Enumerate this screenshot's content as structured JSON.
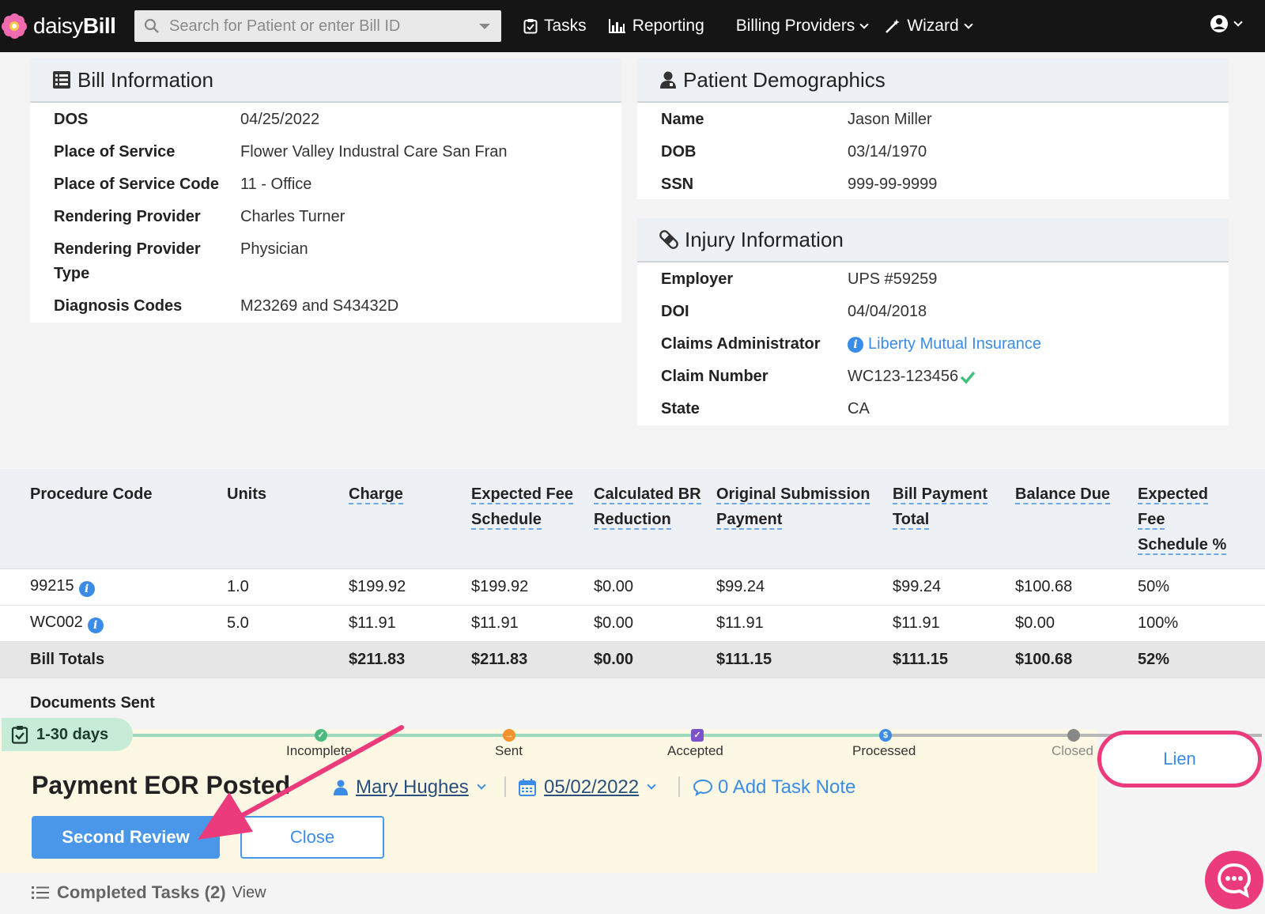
{
  "app": {
    "logo_regular": "daisy",
    "logo_bold": "Bill"
  },
  "nav": {
    "search_placeholder": "Search for Patient or enter Bill ID",
    "tasks": "Tasks",
    "reporting": "Reporting",
    "billing_providers": "Billing Providers",
    "wizard": "Wizard"
  },
  "bill_info": {
    "title": "Bill Information",
    "rows": [
      {
        "label": "DOS",
        "value": "04/25/2022"
      },
      {
        "label": "Place of Service",
        "value": "Flower Valley Industral Care San Fran"
      },
      {
        "label": "Place of Service Code",
        "value": "11 - Office"
      },
      {
        "label": "Rendering Provider",
        "value": "Charles Turner"
      },
      {
        "label_1": "Rendering Provider",
        "label_2": "Type",
        "value": "Physician"
      },
      {
        "label": "Diagnosis Codes",
        "value": "M23269 and S43432D"
      }
    ]
  },
  "demographics": {
    "title": "Patient Demographics",
    "rows": [
      {
        "label": "Name",
        "value": "Jason Miller"
      },
      {
        "label": "DOB",
        "value": "03/14/1970"
      },
      {
        "label": "SSN",
        "value": "999-99-9999"
      }
    ]
  },
  "injury": {
    "title": "Injury Information",
    "rows": [
      {
        "label": "Employer",
        "value": "UPS #59259"
      },
      {
        "label": "DOI",
        "value": "04/04/2018"
      },
      {
        "label": "Claims Administrator",
        "value": "Liberty Mutual Insurance"
      },
      {
        "label": "Claim Number",
        "value": "WC123-123456"
      },
      {
        "label": "State",
        "value": "CA"
      }
    ]
  },
  "procedures": {
    "headers": [
      {
        "l1": "Procedure Code"
      },
      {
        "l1": "Units"
      },
      {
        "l1": "Charge"
      },
      {
        "l1": "Expected Fee",
        "l2": "Schedule"
      },
      {
        "l1": "Calculated BR",
        "l2": "Reduction"
      },
      {
        "l1": "Original Submission",
        "l2": "Payment"
      },
      {
        "l1": "Bill Payment",
        "l2": "Total"
      },
      {
        "l1": "Balance Due"
      },
      {
        "l1": "Expected",
        "l2": "Fee",
        "l3": "Schedule %"
      }
    ],
    "rows": [
      {
        "code": "99215",
        "units": "1.0",
        "charge": "$199.92",
        "expected": "$199.92",
        "br": "$0.00",
        "original": "$99.24",
        "total": "$99.24",
        "balance": "$100.68",
        "pct": "50%"
      },
      {
        "code": "WC002",
        "units": "5.0",
        "charge": "$11.91",
        "expected": "$11.91",
        "br": "$0.00",
        "original": "$11.91",
        "total": "$11.91",
        "balance": "$0.00",
        "pct": "100%"
      }
    ],
    "totals": {
      "label": "Bill Totals",
      "charge": "$211.83",
      "expected": "$211.83",
      "br": "$0.00",
      "original": "$111.15",
      "total": "$111.15",
      "balance": "$100.68",
      "pct": "52%"
    }
  },
  "documents_sent": "Documents Sent",
  "task": {
    "age": "1-30 days",
    "stages": [
      "Incomplete",
      "Sent",
      "Accepted",
      "Processed",
      "Closed"
    ],
    "stage_button": "Lien",
    "title": "Payment EOR Posted",
    "assignee": "Mary Hughes",
    "due_date": "05/02/2022",
    "note": "0 Add Task Note",
    "primary_button": "Second Review",
    "secondary_button": "Close",
    "completed": "Completed Tasks (2)",
    "completed_link": "View"
  },
  "colors": {
    "accent": "#3b8ce6",
    "highlight": "#ec3b7c",
    "progress": "#9fd9bb",
    "task_bg": "#fdf8e4"
  }
}
